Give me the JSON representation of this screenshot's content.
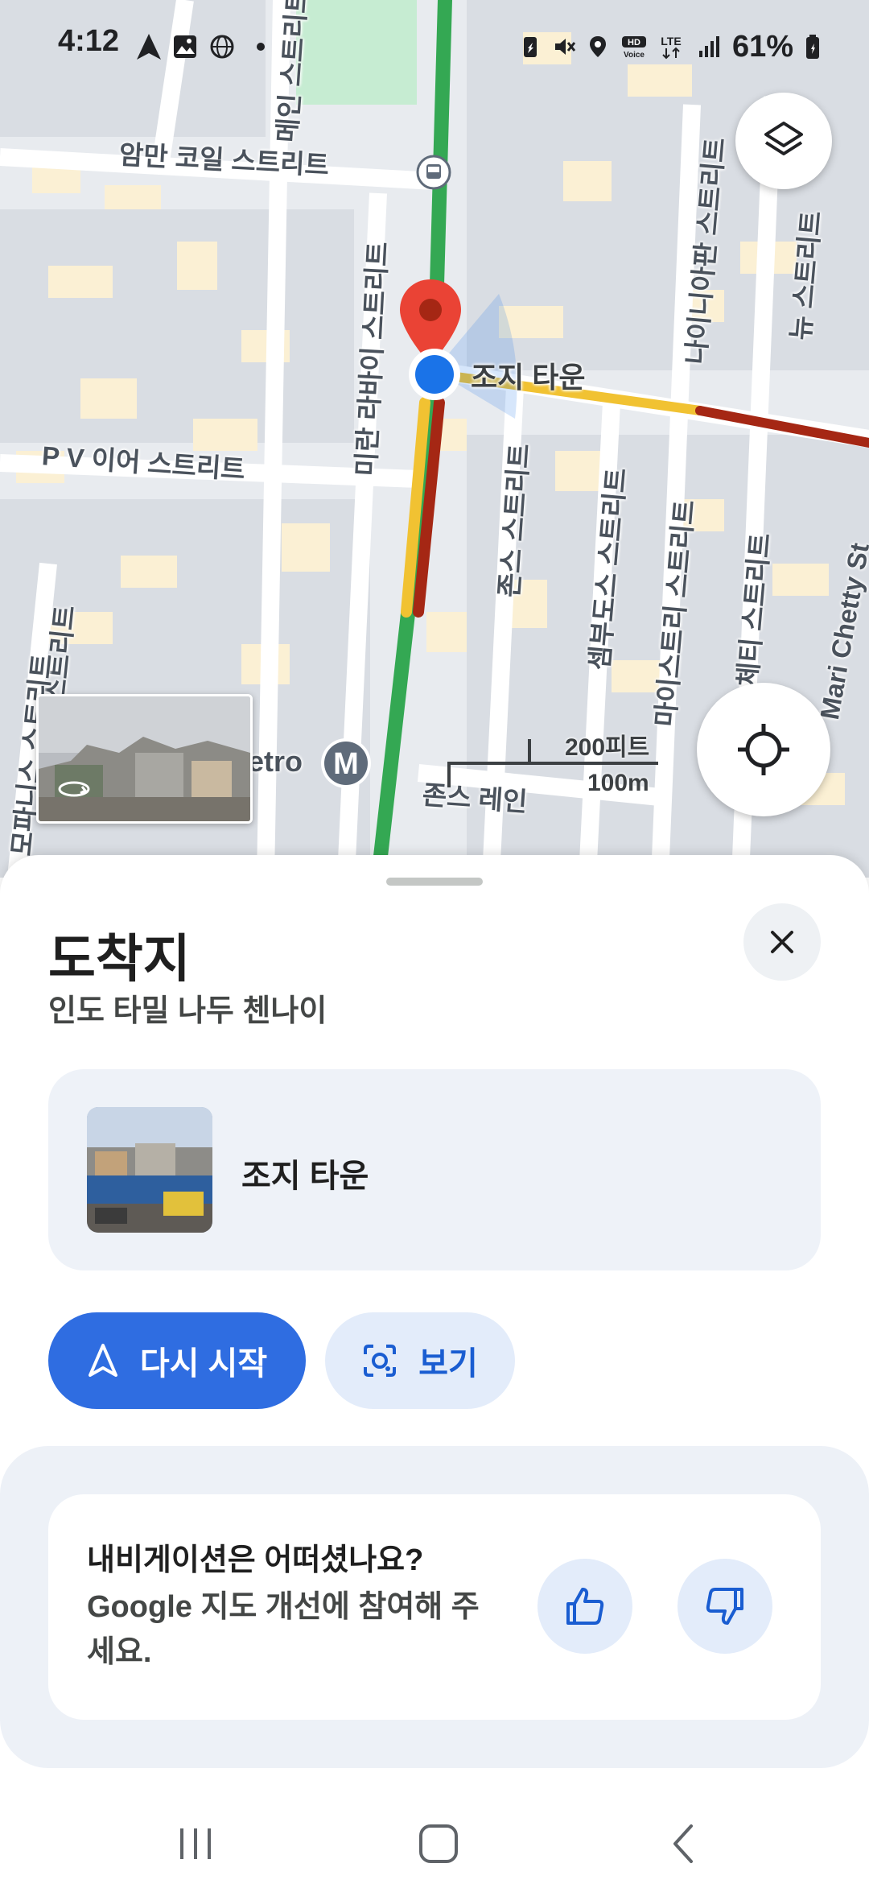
{
  "status_bar": {
    "time": "4:12",
    "battery": "61%",
    "icons": [
      "navigation-arrow-icon",
      "gallery-icon",
      "globe-icon",
      "dot-icon",
      "battery-saver-icon",
      "mute-icon",
      "location-icon",
      "hd-voice-icon",
      "lte-icon",
      "signal-icon",
      "battery-icon"
    ]
  },
  "map": {
    "labels": {
      "amman_coil": "암만 코일 스트리트",
      "main_street": "메인 스트리트",
      "george_town": "조지 타운",
      "pv_ayer": "P V 이어 스트리트",
      "ramani": "미란 라바이 스트리트",
      "johns": "존스 스트리트",
      "nainiappan": "나이니아판 스트리트",
      "new_street": "뉴 스트리트",
      "sembudoss": "셈부도스 스트리트",
      "maistry": "마이스트리 스트리트",
      "appa_chetty": "아파 체티 스트리트",
      "mari_chetty": "Mari Chetty St",
      "johns_lane": "존스 레인",
      "metro": "etro",
      "left_a": "스트리트",
      "left_b": "모파니스 스트리트"
    },
    "scale": {
      "feet": "200피트",
      "meters": "100m"
    },
    "colors": {
      "route_green": "#34a853",
      "route_red": "#a52714",
      "route_yellow": "#f1c232",
      "pin_red": "#ea4335",
      "user_blue": "#1a73e8"
    }
  },
  "sheet": {
    "title": "도착지",
    "subtitle": "인도 타밀 나두 첸나이",
    "place_name": "조지 타운",
    "restart_label": "다시 시작",
    "view_label": "보기",
    "feedback_question": "내비게이션은 어떠셨나요?",
    "feedback_desc": "Google 지도 개선에 참여해 주세요."
  },
  "nav_bar": {
    "icons": [
      "recents-icon",
      "home-icon",
      "back-icon"
    ]
  }
}
